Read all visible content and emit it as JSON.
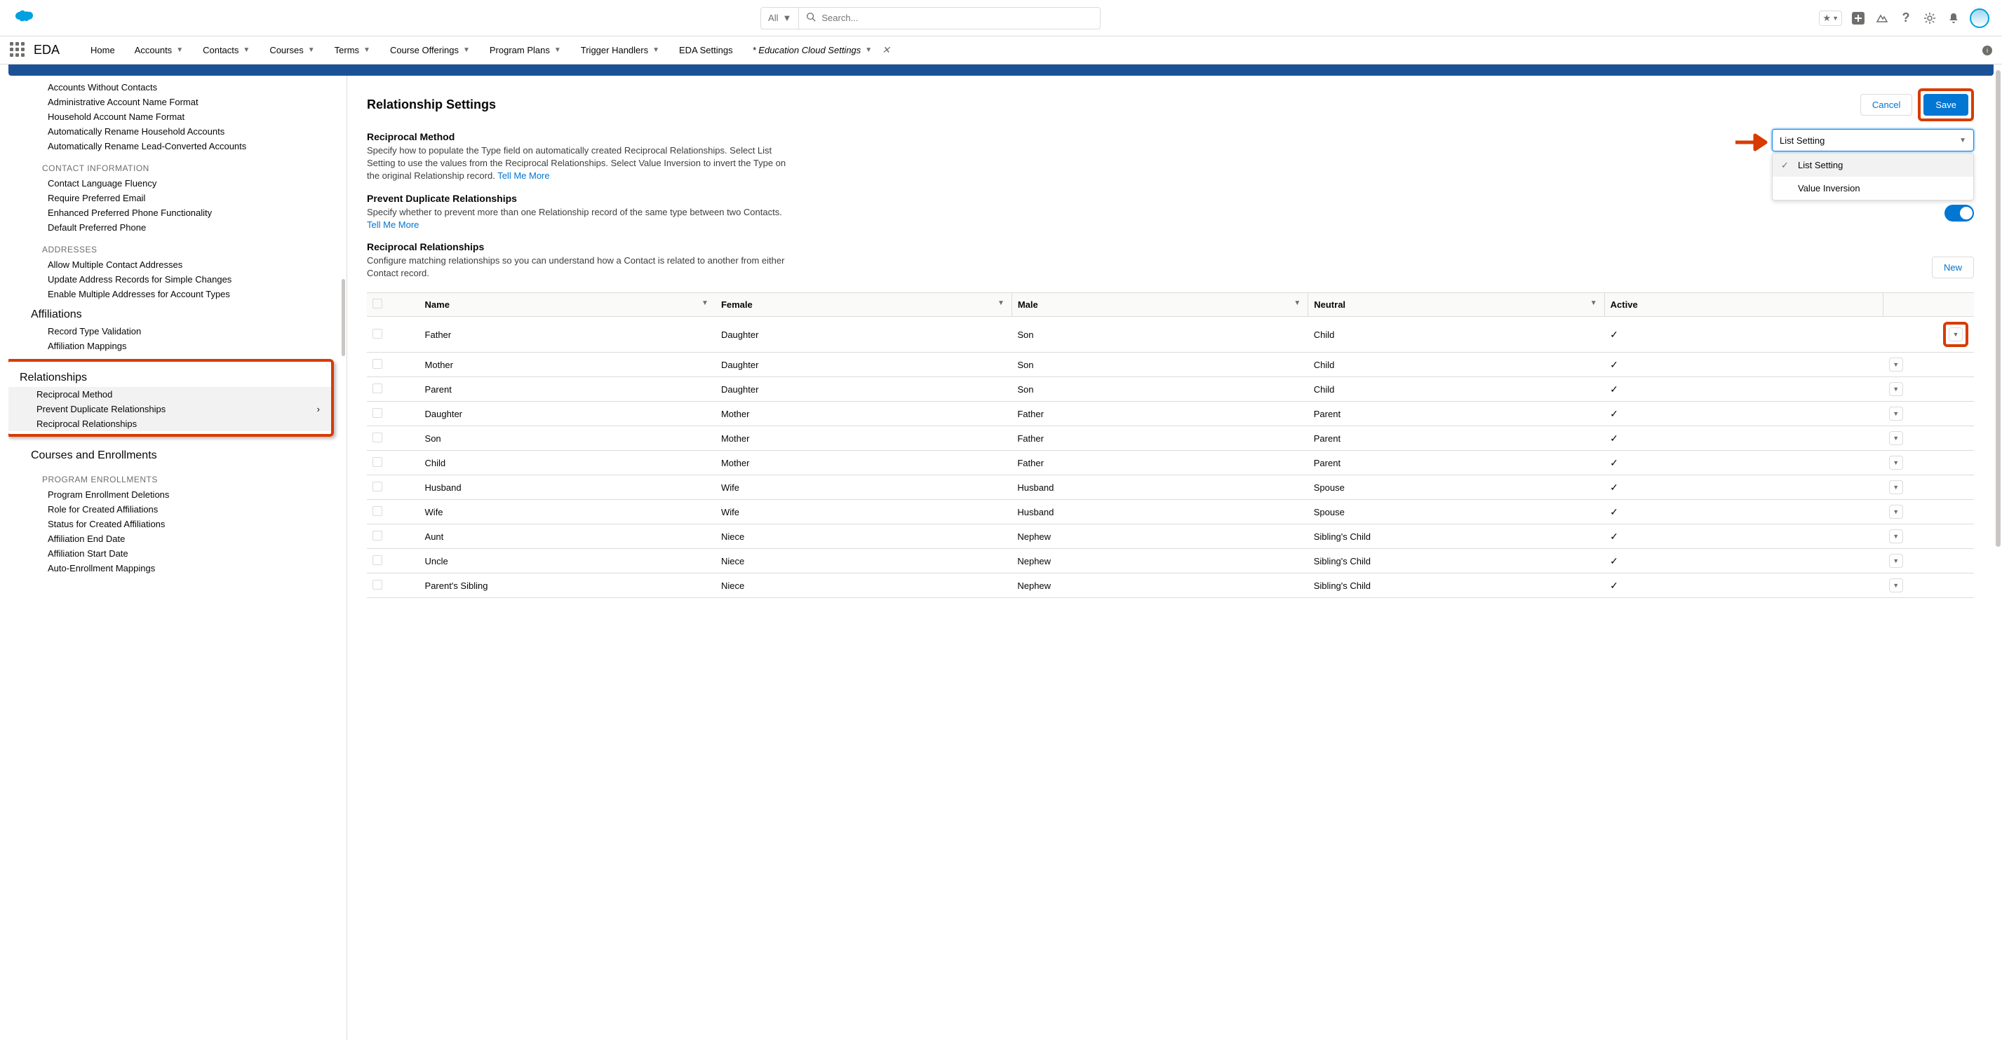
{
  "topbar": {
    "all_label": "All",
    "search_placeholder": "Search..."
  },
  "app_name": "EDA",
  "nav": [
    {
      "label": "Home",
      "caret": false
    },
    {
      "label": "Accounts",
      "caret": true
    },
    {
      "label": "Contacts",
      "caret": true
    },
    {
      "label": "Courses",
      "caret": true
    },
    {
      "label": "Terms",
      "caret": true
    },
    {
      "label": "Course Offerings",
      "caret": true
    },
    {
      "label": "Program Plans",
      "caret": true
    },
    {
      "label": "Trigger Handlers",
      "caret": true
    },
    {
      "label": "EDA Settings",
      "caret": false
    },
    {
      "label": "* Education Cloud Settings",
      "caret": true,
      "close": true,
      "active": true
    }
  ],
  "sidebar": {
    "top_links": [
      "Accounts Without Contacts",
      "Administrative Account Name Format",
      "Household Account Name Format",
      "Automatically Rename Household Accounts",
      "Automatically Rename Lead-Converted Accounts"
    ],
    "contact_info_heading": "CONTACT INFORMATION",
    "contact_info_links": [
      "Contact Language Fluency",
      "Require Preferred Email",
      "Enhanced Preferred Phone Functionality",
      "Default Preferred Phone"
    ],
    "addresses_heading": "ADDRESSES",
    "addresses_links": [
      "Allow Multiple Contact Addresses",
      "Update Address Records for Simple Changes",
      "Enable Multiple Addresses for Account Types"
    ],
    "affiliations_heading": "Affiliations",
    "affiliations_links": [
      "Record Type Validation",
      "Affiliation Mappings"
    ],
    "relationships_heading": "Relationships",
    "relationships_links": [
      "Reciprocal Method",
      "Prevent Duplicate Relationships",
      "Reciprocal Relationships"
    ],
    "courses_heading": "Courses and Enrollments",
    "program_enroll_heading": "PROGRAM ENROLLMENTS",
    "program_enroll_links": [
      "Program Enrollment Deletions",
      "Role for Created Affiliations",
      "Status for Created Affiliations",
      "Affiliation End Date",
      "Affiliation Start Date",
      "Auto-Enrollment Mappings"
    ]
  },
  "main": {
    "page_title": "Relationship Settings",
    "cancel": "Cancel",
    "save": "Save",
    "reciprocal_method": {
      "title": "Reciprocal Method",
      "desc": "Specify how to populate the Type field on automatically created Reciprocal Relationships. Select List Setting to use the values from the Reciprocal Relationships. Select Value Inversion to invert the Type on the original Relationship record. ",
      "link": "Tell Me More"
    },
    "dropdown": {
      "value": "List Setting",
      "options": [
        "List Setting",
        "Value Inversion"
      ]
    },
    "prevent_dup": {
      "title": "Prevent Duplicate Relationships",
      "desc": "Specify whether to prevent more than one Relationship record of the same type between two Contacts. ",
      "link": "Tell Me More"
    },
    "reciprocal_rel": {
      "title": "Reciprocal Relationships",
      "desc": "Configure matching relationships so you can understand how a Contact is related to another from either Contact record.",
      "new": "New"
    },
    "table": {
      "headers": [
        "Name",
        "Female",
        "Male",
        "Neutral",
        "Active"
      ],
      "rows": [
        {
          "name": "Father",
          "female": "Daughter",
          "male": "Son",
          "neutral": "Child",
          "active": true
        },
        {
          "name": "Mother",
          "female": "Daughter",
          "male": "Son",
          "neutral": "Child",
          "active": true
        },
        {
          "name": "Parent",
          "female": "Daughter",
          "male": "Son",
          "neutral": "Child",
          "active": true
        },
        {
          "name": "Daughter",
          "female": "Mother",
          "male": "Father",
          "neutral": "Parent",
          "active": true
        },
        {
          "name": "Son",
          "female": "Mother",
          "male": "Father",
          "neutral": "Parent",
          "active": true
        },
        {
          "name": "Child",
          "female": "Mother",
          "male": "Father",
          "neutral": "Parent",
          "active": true
        },
        {
          "name": "Husband",
          "female": "Wife",
          "male": "Husband",
          "neutral": "Spouse",
          "active": true
        },
        {
          "name": "Wife",
          "female": "Wife",
          "male": "Husband",
          "neutral": "Spouse",
          "active": true
        },
        {
          "name": "Aunt",
          "female": "Niece",
          "male": "Nephew",
          "neutral": "Sibling's Child",
          "active": true
        },
        {
          "name": "Uncle",
          "female": "Niece",
          "male": "Nephew",
          "neutral": "Sibling's Child",
          "active": true
        },
        {
          "name": "Parent's Sibling",
          "female": "Niece",
          "male": "Nephew",
          "neutral": "Sibling's Child",
          "active": true
        }
      ]
    }
  }
}
